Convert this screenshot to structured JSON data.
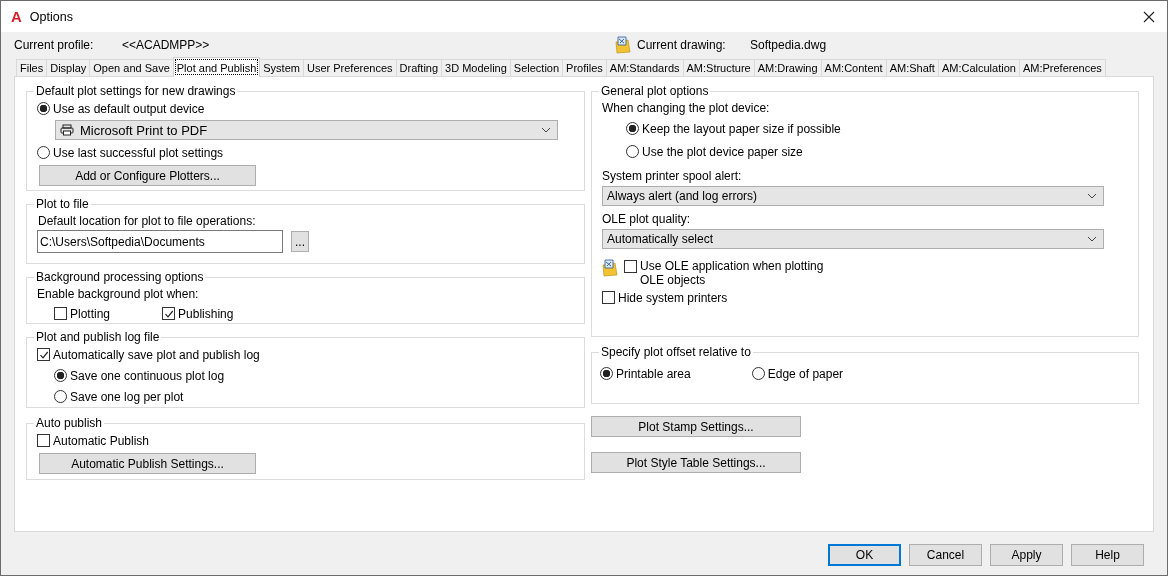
{
  "window": {
    "logo": "A",
    "title": "Options"
  },
  "profile": {
    "label": "Current profile:",
    "value": "<<ACADMPP>>"
  },
  "drawing": {
    "label": "Current drawing:",
    "value": "Softpedia.dwg"
  },
  "tabs": [
    {
      "label": "Files",
      "selected": false
    },
    {
      "label": "Display",
      "selected": false
    },
    {
      "label": "Open and Save",
      "selected": false
    },
    {
      "label": "Plot and Publish",
      "selected": true
    },
    {
      "label": "System",
      "selected": false
    },
    {
      "label": "User Preferences",
      "selected": false
    },
    {
      "label": "Drafting",
      "selected": false
    },
    {
      "label": "3D Modeling",
      "selected": false
    },
    {
      "label": "Selection",
      "selected": false
    },
    {
      "label": "Profiles",
      "selected": false
    },
    {
      "label": "AM:Standards",
      "selected": false
    },
    {
      "label": "AM:Structure",
      "selected": false
    },
    {
      "label": "AM:Drawing",
      "selected": false
    },
    {
      "label": "AM:Content",
      "selected": false
    },
    {
      "label": "AM:Shaft",
      "selected": false
    },
    {
      "label": "AM:Calculation",
      "selected": false
    },
    {
      "label": "AM:Preferences",
      "selected": false
    }
  ],
  "default_plot": {
    "title": "Default plot settings for new drawings",
    "device_option": {
      "label": "Use as default output device",
      "selected": true
    },
    "device": "Microsoft Print to PDF",
    "last_option": {
      "label": "Use last successful plot settings",
      "selected": false
    },
    "button": "Add or Configure Plotters..."
  },
  "plot_to_file": {
    "title": "Plot to file",
    "label": "Default location for plot to file operations:",
    "path": "C:\\Users\\Softpedia\\Documents",
    "browse_button": "..."
  },
  "background": {
    "title": "Background processing options",
    "label": "Enable background plot when:",
    "checkboxes": [
      {
        "label": "Plotting",
        "checked": false
      },
      {
        "label": "Publishing",
        "checked": true
      }
    ]
  },
  "log_file": {
    "title": "Plot and publish log file",
    "auto_save": {
      "label": "Automatically save plot and publish log",
      "checked": true
    },
    "options": [
      {
        "label": "Save one continuous plot log",
        "selected": true
      },
      {
        "label": "Save one log per plot",
        "selected": false
      }
    ]
  },
  "auto_publish": {
    "title": "Auto publish",
    "checkbox": {
      "label": "Automatic Publish",
      "checked": false
    },
    "button": "Automatic Publish Settings..."
  },
  "general": {
    "title": "General plot options",
    "label": "When changing the plot device:",
    "options": [
      {
        "label": "Keep the layout paper size if possible",
        "selected": true
      },
      {
        "label": "Use the plot device paper size",
        "selected": false
      }
    ],
    "spool_label": "System printer spool alert:",
    "spool_value": "Always alert (and log errors)",
    "ole_label": "OLE plot quality:",
    "ole_value": "Automatically select",
    "ole_app": {
      "label": "Use OLE application when plotting OLE objects",
      "checked": false
    },
    "hide_printers": {
      "label": "Hide system printers",
      "checked": false
    }
  },
  "offset": {
    "title": "Specify plot offset relative to",
    "options": [
      {
        "label": "Printable area",
        "selected": true
      },
      {
        "label": "Edge of paper",
        "selected": false
      }
    ]
  },
  "settings_buttons": [
    "Plot Stamp Settings...",
    "Plot Style Table Settings..."
  ],
  "footer_buttons": [
    {
      "label": "OK",
      "default": true
    },
    {
      "label": "Cancel",
      "default": false
    },
    {
      "label": "Apply",
      "default": false
    },
    {
      "label": "Help",
      "default": false
    }
  ]
}
